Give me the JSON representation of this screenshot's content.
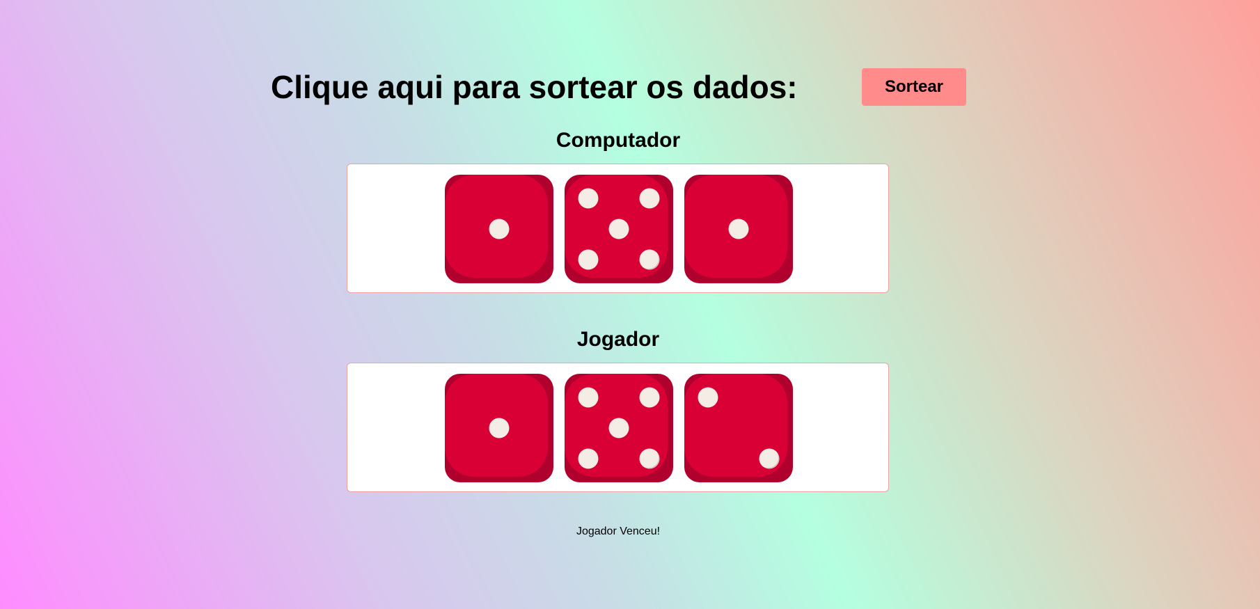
{
  "header": {
    "title": "Clique aqui para sortear os dados:",
    "button_label": "Sortear"
  },
  "computer": {
    "title": "Computador",
    "dice": [
      1,
      5,
      1
    ]
  },
  "player": {
    "title": "Jogador",
    "dice": [
      1,
      5,
      2
    ]
  },
  "result": "Jogador Venceu!",
  "colors": {
    "button": "#ff8c8a",
    "die_face": "#d80035",
    "die_shadow": "#b0002e",
    "pip": "#f3ede6"
  }
}
